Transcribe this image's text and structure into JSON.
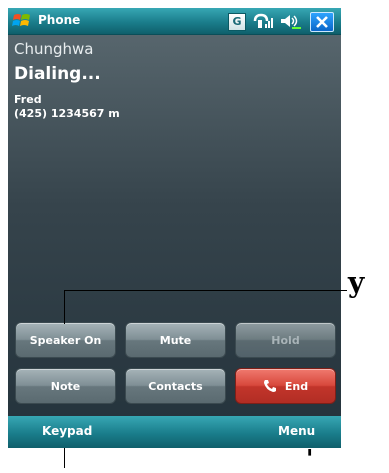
{
  "window": {
    "title": "Phone"
  },
  "tray": {
    "icons": [
      "windows-start-icon",
      "gprs-icon",
      "signal-icon",
      "volume-icon",
      "close-icon"
    ],
    "gprs_label": "G"
  },
  "call": {
    "carrier": "Chunghwa",
    "status": "Dialing...",
    "caller_name": "Fred",
    "caller_number": "(425) 1234567 m"
  },
  "buttons": {
    "speaker": "Speaker On",
    "mute": "Mute",
    "hold": "Hold",
    "note": "Note",
    "contacts": "Contacts",
    "end": "End"
  },
  "softkeys": {
    "left": "Keypad",
    "right": "Menu"
  },
  "callouts": {
    "right": "y",
    "bottom": "'"
  },
  "colors": {
    "titlebar": "#1a7d8b",
    "end_button": "#d8483c",
    "background": "#36444c"
  }
}
